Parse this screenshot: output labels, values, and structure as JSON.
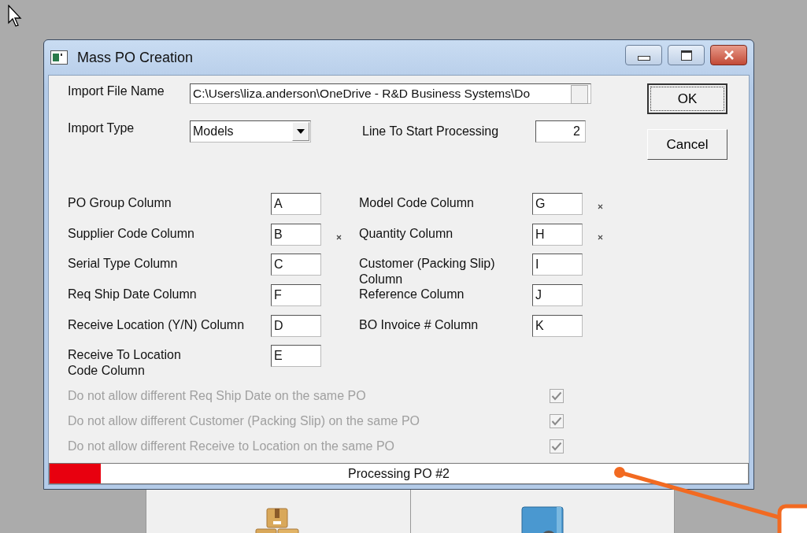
{
  "window": {
    "title": "Mass PO Creation"
  },
  "import_file_name": {
    "label": "Import File Name",
    "value": "C:\\Users\\liza.anderson\\OneDrive - R&D Business Systems\\Do"
  },
  "import_type": {
    "label": "Import Type",
    "value": "Models"
  },
  "line_to_start": {
    "label": "Line To Start Processing",
    "value": "2"
  },
  "buttons": [
    {
      "label": "OK",
      "default": true
    },
    {
      "label": "Cancel",
      "default": false
    }
  ],
  "left_fields": [
    {
      "label": "PO Group Column",
      "value": "A",
      "required": false
    },
    {
      "label": "Supplier Code Column",
      "value": "B",
      "required": true
    },
    {
      "label": "Serial Type Column",
      "value": "C",
      "required": false
    },
    {
      "label": "Req Ship Date Column",
      "value": "F",
      "required": false
    },
    {
      "label": "Receive Location (Y/N) Column",
      "value": "D",
      "required": false
    },
    {
      "label": "Receive To Location\nCode Column",
      "value": "E",
      "required": false
    }
  ],
  "right_fields": [
    {
      "label": "Model Code Column",
      "value": "G",
      "required": true
    },
    {
      "label": "Quantity Column",
      "value": "H",
      "required": true
    },
    {
      "label": "Customer (Packing Slip)\nColumn",
      "value": "I",
      "required": false
    },
    {
      "label": "Reference Column",
      "value": "J",
      "required": false
    },
    {
      "label": "BO Invoice # Column",
      "value": "K",
      "required": false
    }
  ],
  "options": [
    {
      "label": "Do not allow different Req Ship Date on the same PO",
      "checked": true,
      "disabled": true
    },
    {
      "label": "Do not allow different Customer (Packing Slip) on the same PO",
      "checked": true,
      "disabled": true
    },
    {
      "label": "Do not allow different Receive to Location on the same PO",
      "checked": true,
      "disabled": true
    }
  ],
  "progress": {
    "level": 0.073,
    "text": "Processing PO #2"
  }
}
